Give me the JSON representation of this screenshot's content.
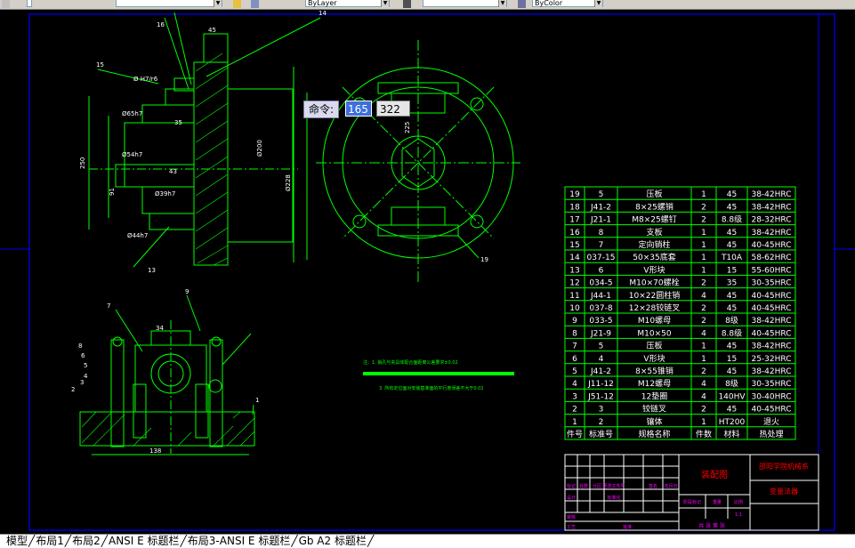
{
  "toolbar": {
    "layer_value": "ByLayer",
    "linetype_value": "",
    "lineweight_value": "ByColor"
  },
  "command": {
    "label": "命令:",
    "x_value": "165",
    "y_value": "322"
  },
  "drawing": {
    "dims": {
      "d45": "45",
      "d15": "15",
      "d16": "16",
      "d14": "14",
      "d35": "35",
      "d43": "43",
      "d65h7": "Ø65h7",
      "d54h7": "Ø54h7",
      "d39h7": "Ø39h7",
      "d44h7": "Ø44h7",
      "h7r6": "Ø H7/r6",
      "d250": "250",
      "d91": "91",
      "d200": "Ø200",
      "d228": "Ø228",
      "d13": "13",
      "d7": "7",
      "d9": "9",
      "d34": "34",
      "d138": "138",
      "d19": "19",
      "d225": "225"
    },
    "tech_note_1": "注：1. 销孔与夹具体配合面距离公差要求±0.02",
    "tech_note_2": "3. 所有定位面对安装基准面的平行度误差不大于0.02",
    "balloons_left": [
      "8",
      "6",
      "5",
      "4",
      "3",
      "2"
    ],
    "balloon_right": "1"
  },
  "bom": {
    "rows": [
      {
        "no": "19",
        "code": "5",
        "name": "压板",
        "qty": "1",
        "mat": "45",
        "heat": "38-42HRC"
      },
      {
        "no": "18",
        "code": "J41-2",
        "name": "8×25螺销",
        "qty": "2",
        "mat": "45",
        "heat": "38-42HRC"
      },
      {
        "no": "17",
        "code": "J21-1",
        "name": "M8×25螺钉",
        "qty": "2",
        "mat": "8.8级",
        "heat": "28-32HRC"
      },
      {
        "no": "16",
        "code": "8",
        "name": "支板",
        "qty": "1",
        "mat": "45",
        "heat": "38-42HRC"
      },
      {
        "no": "15",
        "code": "7",
        "name": "定向销柱",
        "qty": "1",
        "mat": "45",
        "heat": "40-45HRC"
      },
      {
        "no": "14",
        "code": "037-15",
        "name": "50×35底套",
        "qty": "1",
        "mat": "T10A",
        "heat": "58-62HRC"
      },
      {
        "no": "13",
        "code": "6",
        "name": "V形块",
        "qty": "1",
        "mat": "15",
        "heat": "55-60HRC"
      },
      {
        "no": "12",
        "code": "034-5",
        "name": "M10×70螺栓",
        "qty": "2",
        "mat": "35",
        "heat": "30-35HRC"
      },
      {
        "no": "11",
        "code": "J44-1",
        "name": "10×22圆柱销",
        "qty": "4",
        "mat": "45",
        "heat": "40-45HRC"
      },
      {
        "no": "10",
        "code": "037-8",
        "name": "12×28铰链叉",
        "qty": "2",
        "mat": "45",
        "heat": "40-45HRC"
      },
      {
        "no": "9",
        "code": "033-5",
        "name": "M10螺母",
        "qty": "2",
        "mat": "8级",
        "heat": "38-42HRC"
      },
      {
        "no": "8",
        "code": "J21-9",
        "name": "M10×50",
        "qty": "4",
        "mat": "8.8级",
        "heat": "40-45HRC"
      },
      {
        "no": "7",
        "code": "5",
        "name": "压板",
        "qty": "1",
        "mat": "45",
        "heat": "38-42HRC"
      },
      {
        "no": "6",
        "code": "4",
        "name": "V形块",
        "qty": "1",
        "mat": "15",
        "heat": "25-32HRC"
      },
      {
        "no": "5",
        "code": "J41-2",
        "name": "8×55锥销",
        "qty": "2",
        "mat": "45",
        "heat": "38-42HRC"
      },
      {
        "no": "4",
        "code": "J11-12",
        "name": "M12螺母",
        "qty": "4",
        "mat": "8级",
        "heat": "30-35HRC"
      },
      {
        "no": "3",
        "code": "J51-12",
        "name": "12垫圈",
        "qty": "4",
        "mat": "140HV",
        "heat": "30-40HRC"
      },
      {
        "no": "2",
        "code": "3",
        "name": "铰链叉",
        "qty": "2",
        "mat": "45",
        "heat": "40-45HRC"
      },
      {
        "no": "1",
        "code": "2",
        "name": "镶体",
        "qty": "1",
        "mat": "HT200",
        "heat": "退火"
      }
    ],
    "header": {
      "no": "件号",
      "code": "标准号",
      "name": "规格名称",
      "qty": "件数",
      "mat": "材料",
      "heat": "热处理"
    }
  },
  "title_block": {
    "drawing_name": "装配图",
    "school": "邵阳学院机械系",
    "design": "变量法器",
    "col_labels": [
      "标记",
      "处数",
      "分区",
      "更改文件号",
      "签名",
      "年月日"
    ],
    "design_label": "设计",
    "standard_label": "标准化",
    "stage_labels": [
      "阶段标记",
      "重量",
      "比例"
    ],
    "scale": "1:1",
    "review_label": "审核",
    "process_label": "工艺",
    "approve_label": "批准",
    "sheet_text": "共  张 第  张"
  },
  "tabs": {
    "items": [
      "模型",
      "布局1",
      "布局2",
      "ANSI E 标题栏",
      "布局3-ANSI E 标题栏",
      "Gb A2 标题栏"
    ]
  },
  "colors": {
    "background": "#000000",
    "geometry": "#00ff00",
    "border": "#0000ff",
    "annotation": "#ffffff",
    "title_text": "#ff00ff",
    "title_red": "#ff0000"
  }
}
